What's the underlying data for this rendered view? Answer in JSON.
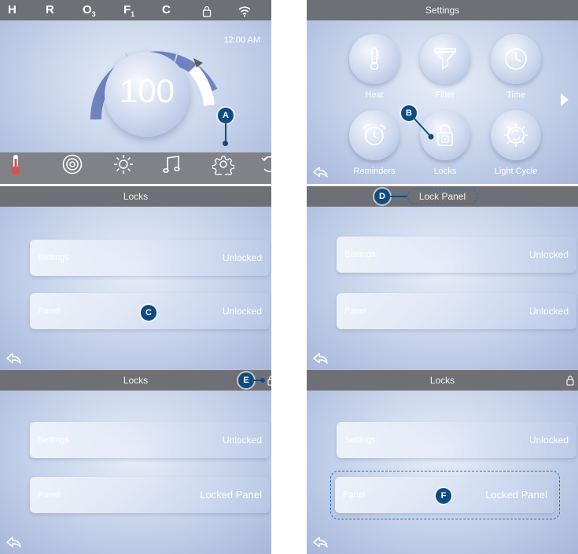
{
  "home": {
    "status_letters": [
      {
        "icon": "heat-status-icon",
        "text": "H"
      },
      {
        "icon": "recirc-status-icon",
        "text": "R"
      },
      {
        "icon": "ozone-status-icon",
        "text": "O",
        "sub": "3"
      },
      {
        "icon": "filter-status-icon",
        "text": "F",
        "sub": "1"
      },
      {
        "icon": "cleanup-status-icon",
        "text": "C"
      }
    ],
    "time": "12:00 AM",
    "temperature": "100",
    "callout": "A",
    "nav_icons": [
      "thermometer-icon",
      "jets-icon",
      "light-icon",
      "music-icon",
      "settings-gear-icon",
      "flip-icon"
    ]
  },
  "settings": {
    "title": "Settings",
    "items": [
      {
        "label": "Heat",
        "icon": "thermometer-icon"
      },
      {
        "label": "Filter",
        "icon": "filter-funnel-icon"
      },
      {
        "label": "Time",
        "icon": "clock-icon"
      },
      {
        "label": "Reminders",
        "icon": "alarm-clock-icon"
      },
      {
        "label": "Locks",
        "icon": "padlock-icon"
      },
      {
        "label": "Light Cycle",
        "icon": "light-cycle-icon"
      }
    ],
    "callout": "B"
  },
  "locks_initial": {
    "title": "Locks",
    "rows": [
      {
        "label": "Settings",
        "value": "Unlocked"
      },
      {
        "label": "Panel",
        "value": "Unlocked"
      }
    ],
    "callout": "C"
  },
  "lock_panel_confirm": {
    "title": "Lock Panel",
    "rows": [
      {
        "label": "Settings",
        "value": "Unlocked"
      },
      {
        "label": "Panel",
        "value": "Unlocked"
      }
    ],
    "callout": "D"
  },
  "locks_locked": {
    "title": "Locks",
    "rows": [
      {
        "label": "Settings",
        "value": "Unlocked"
      },
      {
        "label": "Panel",
        "value": "Locked Panel"
      }
    ],
    "callout": "E"
  },
  "locks_locked_highlight": {
    "title": "Locks",
    "rows": [
      {
        "label": "Settings",
        "value": "Unlocked"
      },
      {
        "label": "Panel",
        "value": "Locked Panel"
      }
    ],
    "callout": "F"
  },
  "colors": {
    "callout": "#0f4c81",
    "title_bar": "#6e7075",
    "thermometer_red": "#d9534f"
  }
}
